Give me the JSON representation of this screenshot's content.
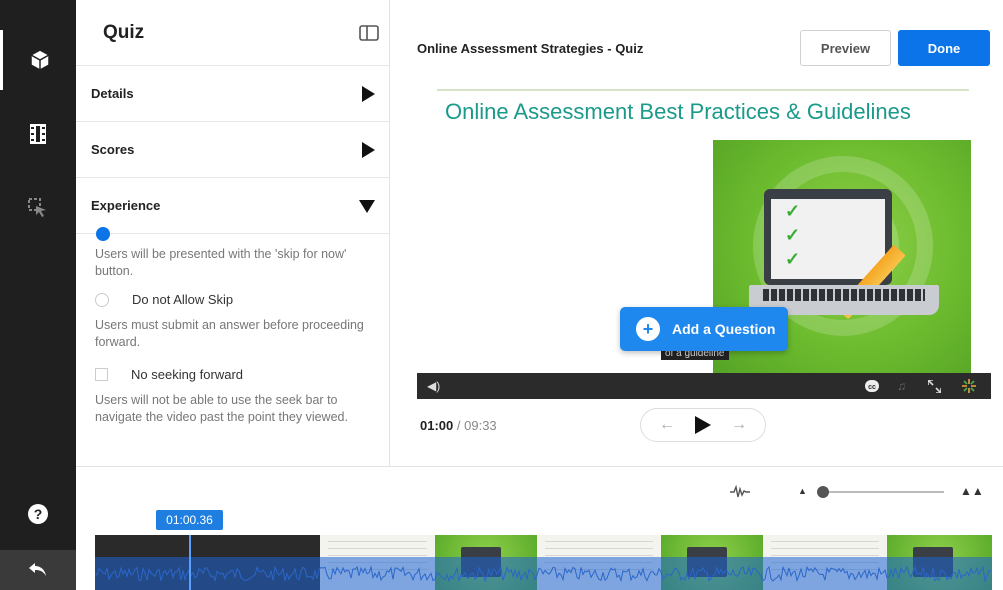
{
  "rail": {
    "icons": [
      "cube-icon",
      "film-icon",
      "cursor-icon",
      "help-icon",
      "back-icon"
    ]
  },
  "panel": {
    "title": "Quiz",
    "sections": [
      {
        "label": "Details",
        "expanded": false
      },
      {
        "label": "Scores",
        "expanded": false
      },
      {
        "label": "Experience",
        "expanded": true
      }
    ],
    "skip_desc": "Users will be presented with the 'skip for now' button.",
    "no_skip_label": "Do not Allow Skip",
    "no_skip_desc": "Users must submit an answer before proceeding forward.",
    "no_seek_label": "No seeking forward",
    "no_seek_desc": "Users will not be able to use the seek bar to navigate the video past the point they viewed."
  },
  "header": {
    "title": "Online Assessment Strategies - Quiz",
    "preview_label": "Preview",
    "done_label": "Done"
  },
  "video": {
    "slide_title": "Online Assessment Best Practices & Guidelines",
    "add_question_label": "Add a Question",
    "caption": "of a guideline",
    "current_time": "01:00",
    "separator": "/",
    "total_time": "09:33"
  },
  "timeline": {
    "marker_time": "01:00.36"
  },
  "colors": {
    "accent": "#0a74e8",
    "rail": "#1f1f1f",
    "slide_title": "#1a9a8a"
  }
}
